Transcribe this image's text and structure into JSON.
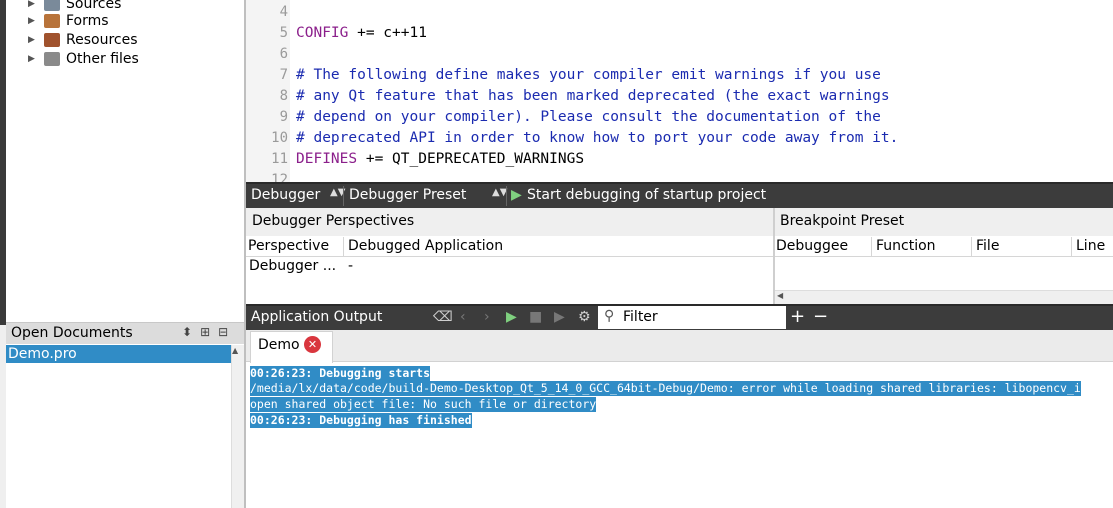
{
  "project_tree": {
    "items": [
      {
        "label": "Sources",
        "icon": "sources-folder-icon",
        "color": "#7a8a9a"
      },
      {
        "label": "Forms",
        "icon": "forms-folder-icon",
        "color": "#b8733a"
      },
      {
        "label": "Resources",
        "icon": "resources-folder-icon",
        "color": "#a0522d"
      },
      {
        "label": "Other files",
        "icon": "other-files-folder-icon",
        "color": "#8a8a8a"
      }
    ]
  },
  "open_documents": {
    "title": "Open Documents",
    "items": [
      "Demo.pro"
    ]
  },
  "editor": {
    "lines": [
      {
        "num": "4",
        "text": ""
      },
      {
        "num": "5",
        "kw": "CONFIG",
        "rest": " += c++11"
      },
      {
        "num": "6",
        "text": ""
      },
      {
        "num": "7",
        "comment": "# The following define makes your compiler emit warnings if you use"
      },
      {
        "num": "8",
        "comment": "# any Qt feature that has been marked deprecated (the exact warnings"
      },
      {
        "num": "9",
        "comment": "# depend on your compiler). Please consult the documentation of the"
      },
      {
        "num": "10",
        "comment": "# deprecated API in order to know how to port your code away from it."
      },
      {
        "num": "11",
        "kw": "DEFINES",
        "rest": " += QT_DEPRECATED_WARNINGS"
      },
      {
        "num": "12",
        "text": ""
      }
    ]
  },
  "debugger_toolbar": {
    "mode": "Debugger",
    "preset": "Debugger Preset",
    "start_label": "Start debugging of startup project"
  },
  "perspectives": {
    "title": "Debugger Perspectives",
    "columns": [
      "Perspective",
      "Debugged Application"
    ],
    "rows": [
      [
        "Debugger ...",
        "-"
      ]
    ]
  },
  "breakpoint_preset": {
    "title": "Breakpoint Preset",
    "columns": [
      "Debuggee",
      "Function",
      "File",
      "Line"
    ]
  },
  "application_output": {
    "title": "Application Output",
    "filter_placeholder": "Filter",
    "tab_label": "Demo",
    "lines": [
      "00:26:23: Debugging starts",
      "/media/lx/data/code/build-Demo-Desktop_Qt_5_14_0_GCC_64bit-Debug/Demo: error while loading shared libraries: libopencv_i",
      "open shared object file: No such file or directory",
      "00:26:23: Debugging has finished"
    ]
  },
  "colors": {
    "selection": "#308cc6",
    "toolbar": "#3c3c3c",
    "keyword": "#8b1f8b",
    "comment": "#1b2bb0",
    "close_badge": "#d9363e"
  }
}
